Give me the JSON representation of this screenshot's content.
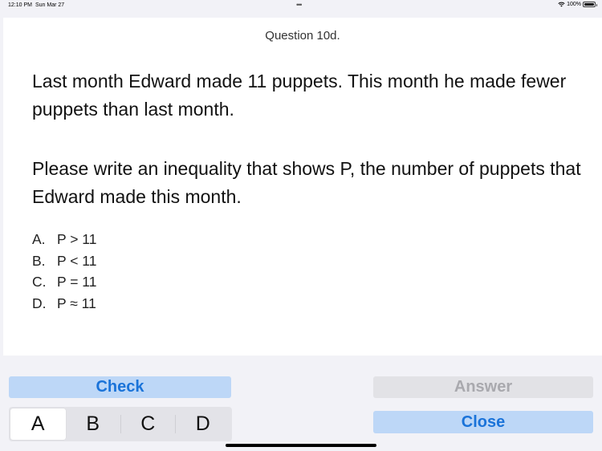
{
  "status_bar": {
    "time": "12:10 PM",
    "date": "Sun Mar 27",
    "battery": "100%",
    "wifi_icon": "wifi-icon",
    "battery_icon": "battery-icon",
    "multitask_icon": "ellipsis-icon"
  },
  "question": {
    "title": "Question 10d.",
    "paragraph_1": "Last month Edward made 11 puppets.  This month he made fewer puppets than last month.",
    "paragraph_2": "Please write an inequality that shows P, the number of puppets that Edward made this month.",
    "choices": [
      {
        "letter": "A.",
        "text": "P > 11"
      },
      {
        "letter": "B.",
        "text": "P < 11"
      },
      {
        "letter": "C.",
        "text": "P = 11"
      },
      {
        "letter": "D.",
        "text": "P ≈ 11"
      }
    ]
  },
  "controls": {
    "check_label": "Check",
    "answer_label": "Answer",
    "close_label": "Close",
    "segments": [
      "A",
      "B",
      "C",
      "D"
    ],
    "selected_segment": "A"
  },
  "colors": {
    "accent": "#1a73d9",
    "button_bg": "#bdd7f7",
    "disabled_text": "#a9a9ae"
  }
}
